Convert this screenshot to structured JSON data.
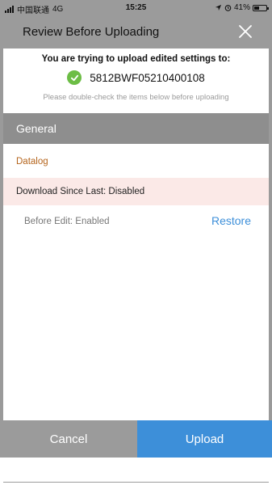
{
  "status_bar": {
    "carrier": "中国联通",
    "network": "4G",
    "time": "15:25",
    "battery": "41%",
    "battery_level": 0.41
  },
  "dialog": {
    "title": "Review Before Uploading",
    "close_icon": "close-icon"
  },
  "intro": {
    "line1": "You are trying to upload edited settings to:",
    "device_id": "5812BWF05210400108",
    "hint": "Please double-check the items below before uploading",
    "check_color": "#6cbd45"
  },
  "section": {
    "title": "General"
  },
  "category": {
    "name": "Datalog",
    "color": "#b5651d"
  },
  "change": {
    "label": "Download Since Last: Disabled",
    "before": "Before Edit: Enabled",
    "restore_label": "Restore",
    "highlight_color": "#fbe9e7"
  },
  "footer": {
    "cancel_label": "Cancel",
    "upload_label": "Upload",
    "accent": "#3d8fd9"
  }
}
